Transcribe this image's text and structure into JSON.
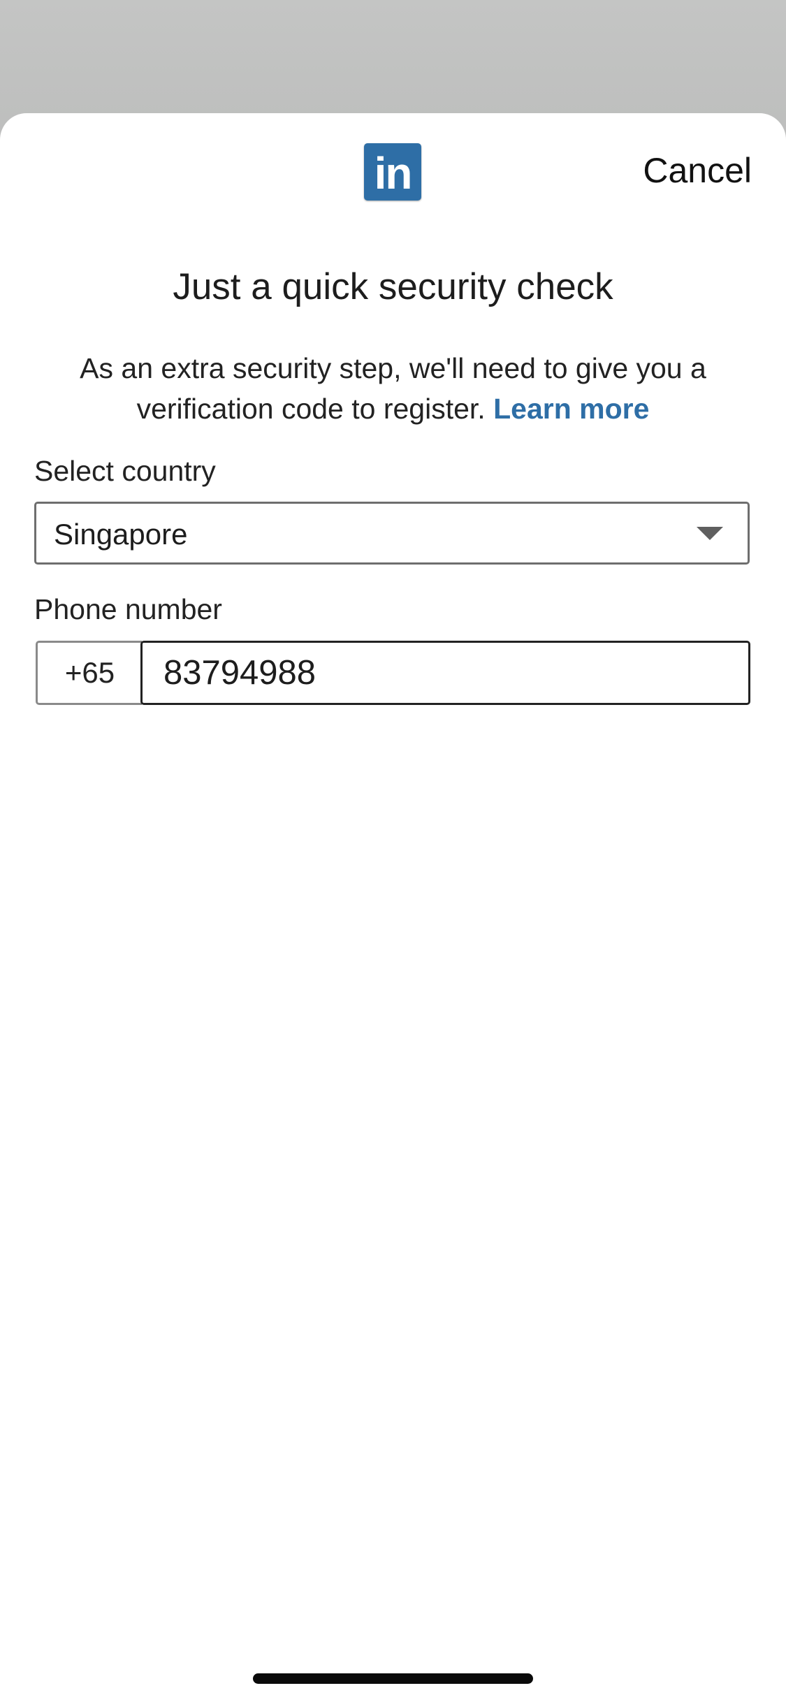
{
  "header": {
    "logo_text": "in",
    "cancel_label": "Cancel"
  },
  "main": {
    "title": "Just a quick security check",
    "description": "As an extra security step, we'll need to give you a verification code to register.",
    "learn_more_label": "Learn more"
  },
  "country": {
    "label": "Select country",
    "selected": "Singapore"
  },
  "phone": {
    "label": "Phone number",
    "prefix": "+65",
    "value": "83794988"
  },
  "colors": {
    "brand": "#2e6ea6",
    "backdrop": "#c4c5c4"
  },
  "icons": {
    "logo": "linkedin-logo-icon",
    "dropdown": "chevron-down-icon"
  }
}
